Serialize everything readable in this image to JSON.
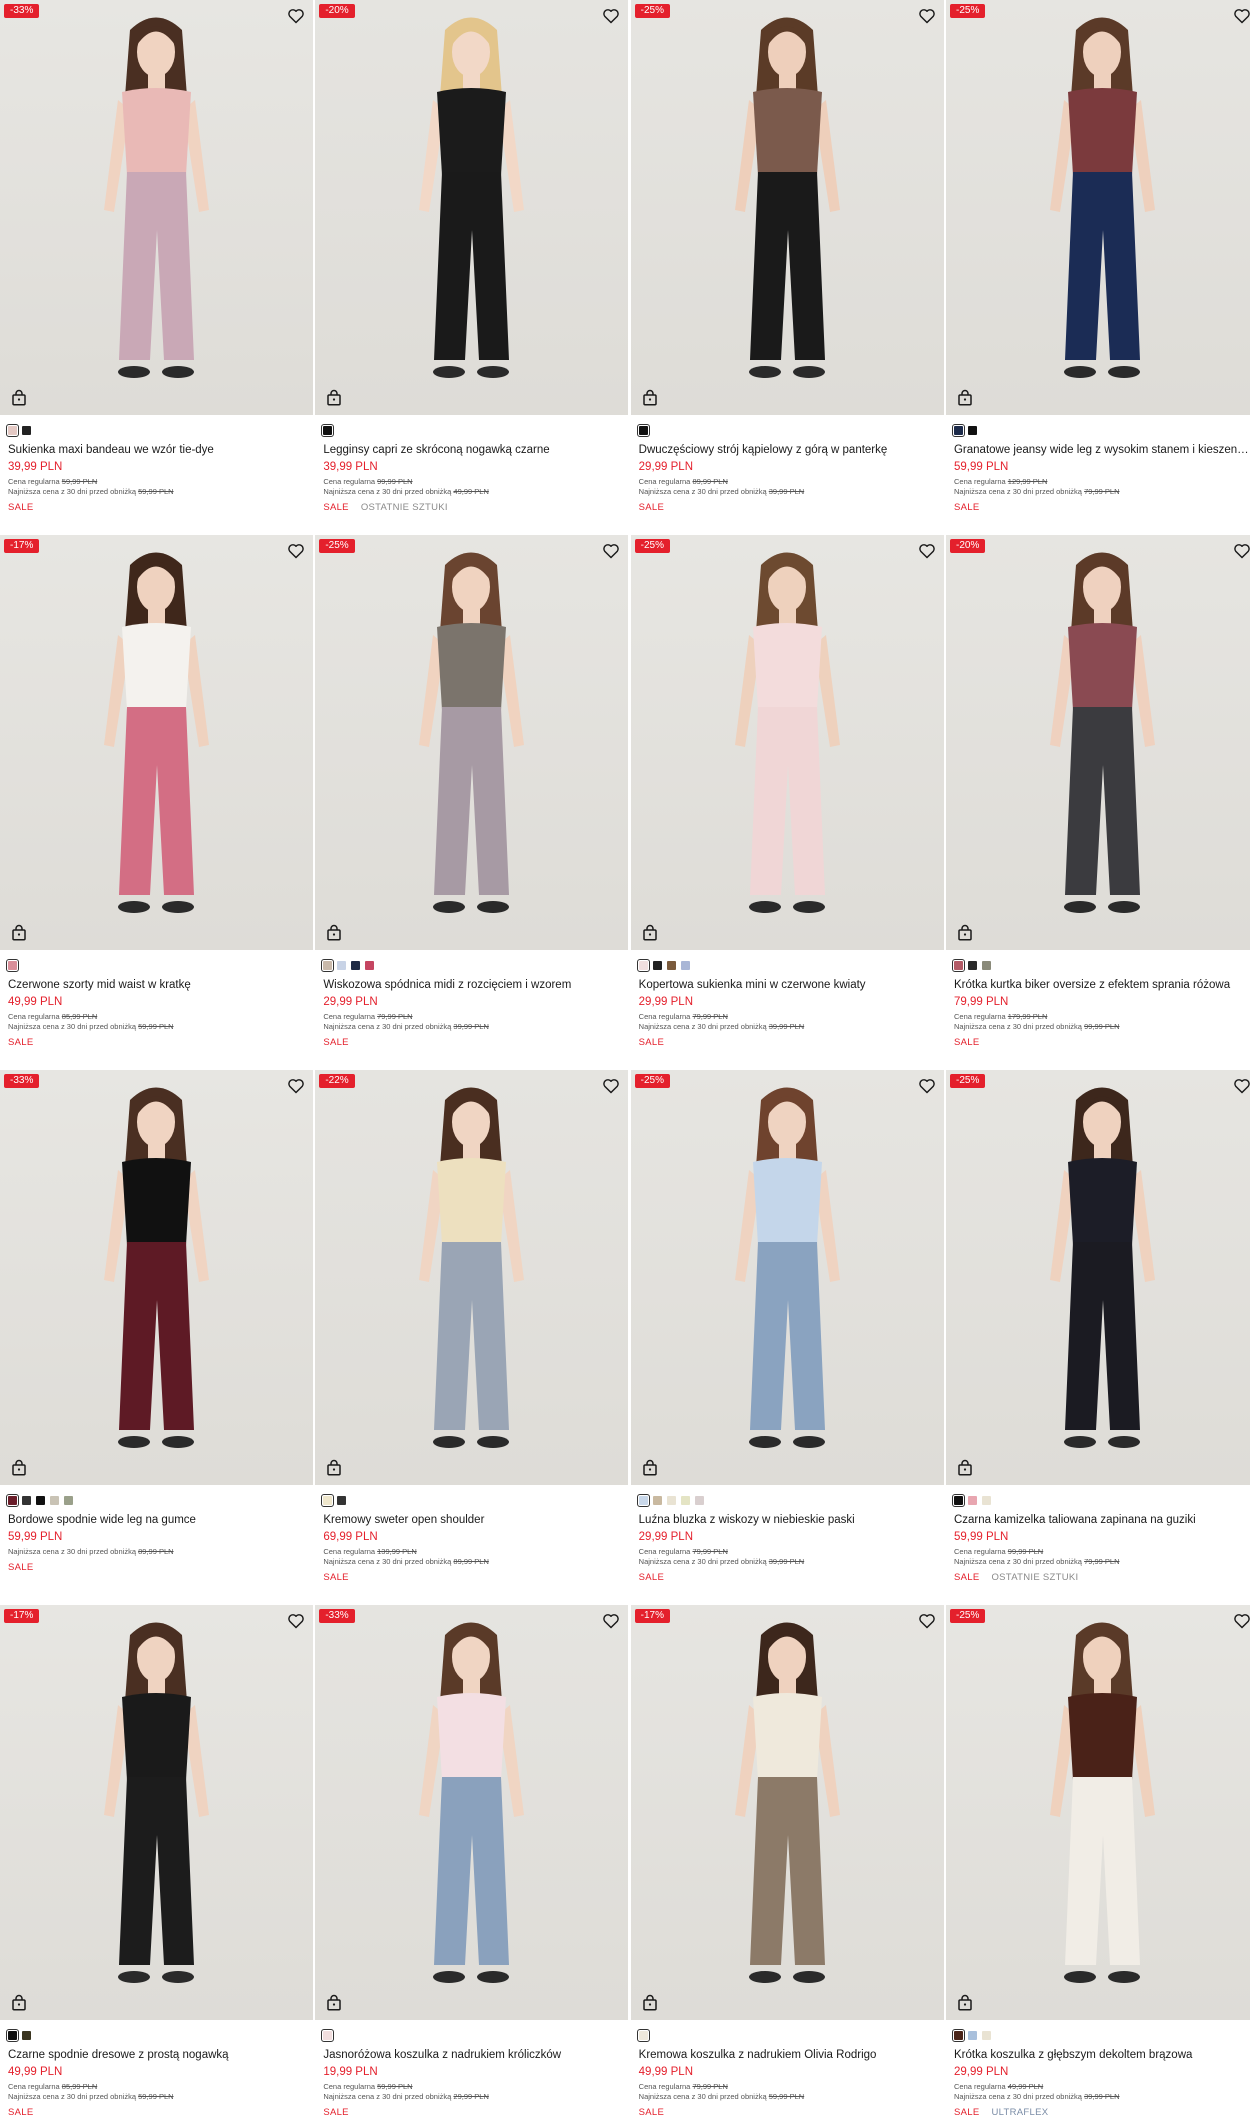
{
  "labels": {
    "regular_prefix": "Cena regularna",
    "lowest_prefix": "Najniższa cena z 30 dni przed obniżką"
  },
  "icons": {
    "wishlist": "heart-outline-icon",
    "quick_add": "shopping-bag-icon"
  },
  "colors": {
    "accent": "#e4202c",
    "text": "#1a1a1a",
    "muted": "#8a8a8a",
    "photo_bg": "#e8e7e4"
  },
  "products": [
    {
      "badge": "-33%",
      "name": "Sukienka maxi bandeau we wzór tie-dye",
      "price": "39,99 PLN",
      "regular": "59,99 PLN",
      "lowest": "59,99 PLN",
      "tags": [
        "SALE"
      ],
      "swatches": [
        "#e4c9c4",
        "#222222"
      ],
      "bg": "#e7e6e2",
      "top": "#e9b9b6",
      "bottom": "#c9a8b6",
      "skin": "#f0d3c1",
      "hair": "#4a2f22"
    },
    {
      "badge": "-20%",
      "name": "Legginsy capri ze skróconą nogawką czarne",
      "price": "39,99 PLN",
      "regular": "99,99 PLN",
      "lowest": "49,99 PLN",
      "tags": [
        "SALE",
        "OSTATNIE SZTUKI"
      ],
      "swatches": [
        "#111111"
      ],
      "bg": "#e5e4e0",
      "top": "#1b1b1b",
      "bottom": "#1a1a1a",
      "skin": "#f2d8c7",
      "hair": "#e3c58c"
    },
    {
      "badge": "-25%",
      "name": "Dwuczęściowy strój kąpielowy z górą w panterkę",
      "price": "29,99 PLN",
      "regular": "89,99 PLN",
      "lowest": "39,99 PLN",
      "tags": [
        "SALE"
      ],
      "swatches": [
        "#111111"
      ],
      "bg": "#e6e5e1",
      "top": "#7b5a4c",
      "bottom": "#1a1a1a",
      "skin": "#eecfbb",
      "hair": "#5b3b27"
    },
    {
      "badge": "-25%",
      "name": "Granatowe jeansy wide leg z wysokim stanem i kieszeniami",
      "price": "59,99 PLN",
      "regular": "129,99 PLN",
      "lowest": "79,99 PLN",
      "tags": [
        "SALE"
      ],
      "swatches": [
        "#1c2a4a",
        "#111111"
      ],
      "bg": "#e6e5e1",
      "top": "#7b3a3d",
      "bottom": "#1b2c55",
      "skin": "#eed0bd",
      "hair": "#5b3a28"
    },
    {
      "badge": "-17%",
      "name": "Czerwone szorty mid waist w kratkę",
      "price": "49,99 PLN",
      "regular": "85,99 PLN",
      "lowest": "59,99 PLN",
      "tags": [
        "SALE"
      ],
      "swatches": [
        "#d98e99"
      ],
      "bg": "#e7e6e2",
      "top": "#f4f2ee",
      "bottom": "#d36e84",
      "skin": "#efd2bf",
      "hair": "#3f271b"
    },
    {
      "badge": "-25%",
      "name": "Wiskozowa spódnica midi z rozcięciem i wzorem",
      "price": "29,99 PLN",
      "regular": "79,99 PLN",
      "lowest": "39,99 PLN",
      "tags": [
        "SALE"
      ],
      "swatches": [
        "#c9b9aa",
        "#c8d3e6",
        "#1e2a44",
        "#c54561"
      ],
      "bg": "#e6e5e1",
      "top": "#7b746c",
      "bottom": "#a79aa4",
      "skin": "#f0d3c0",
      "hair": "#6a4430"
    },
    {
      "badge": "-25%",
      "name": "Kopertowa sukienka mini w czerwone kwiaty",
      "price": "29,99 PLN",
      "regular": "79,99 PLN",
      "lowest": "39,99 PLN",
      "tags": [
        "SALE"
      ],
      "swatches": [
        "#f0dede",
        "#222222",
        "#7a5a3c",
        "#a9b6d6"
      ],
      "bg": "#e7e6e2",
      "top": "#f3dcdc",
      "bottom": "#f0d6d6",
      "skin": "#eed1bd",
      "hair": "#6d4a30"
    },
    {
      "badge": "-20%",
      "name": "Krótka kurtka biker oversize z efektem sprania różowa",
      "price": "79,99 PLN",
      "regular": "179,99 PLN",
      "lowest": "99,99 PLN",
      "tags": [
        "SALE"
      ],
      "swatches": [
        "#b35a66",
        "#2a2a2a",
        "#8a8a7a"
      ],
      "bg": "#e6e5e1",
      "top": "#8a4a52",
      "bottom": "#3b3b3f",
      "skin": "#efd1bf",
      "hair": "#5c3a28"
    },
    {
      "badge": "-33%",
      "name": "Bordowe spodnie wide leg na gumce",
      "price": "59,99 PLN",
      "regular": "",
      "lowest": "89,99 PLN",
      "tags": [
        "SALE"
      ],
      "swatches": [
        "#6a1d2a",
        "#333333",
        "#111111",
        "#c9c3b5",
        "#9aa08a"
      ],
      "bg": "#e7e6e2",
      "top": "#111111",
      "bottom": "#5e1a25",
      "skin": "#f0d4c2",
      "hair": "#4a2f22"
    },
    {
      "badge": "-22%",
      "name": "Kremowy sweter open shoulder",
      "price": "69,99 PLN",
      "regular": "139,99 PLN",
      "lowest": "89,99 PLN",
      "tags": [
        "SALE"
      ],
      "swatches": [
        "#efe7cc",
        "#333333"
      ],
      "bg": "#e5e4e0",
      "top": "#ede0bf",
      "bottom": "#9aa5b5",
      "skin": "#f0d5c3",
      "hair": "#4a2e20"
    },
    {
      "badge": "-25%",
      "name": "Luźna bluzka z wiskozy w niebieskie paski",
      "price": "29,99 PLN",
      "regular": "79,99 PLN",
      "lowest": "39,99 PLN",
      "tags": [
        "SALE"
      ],
      "swatches": [
        "#c9d8ea",
        "#c9b9a0",
        "#e9e3d3",
        "#e4e4c4",
        "#d9cfcf"
      ],
      "bg": "#e6e5e1",
      "top": "#c4d6ea",
      "bottom": "#8aa3c0",
      "skin": "#efd3c1",
      "hair": "#6f432e"
    },
    {
      "badge": "-25%",
      "name": "Czarna kamizelka taliowana zapinana na guziki",
      "price": "59,99 PLN",
      "regular": "99,99 PLN",
      "lowest": "79,99 PLN",
      "tags": [
        "SALE",
        "OSTATNIE SZTUKI"
      ],
      "swatches": [
        "#111111",
        "#e8a6b0",
        "#e9e3d3"
      ],
      "bg": "#e6e5e1",
      "top": "#1c1d27",
      "bottom": "#1b1b22",
      "skin": "#efd2bf",
      "hair": "#3d271c"
    },
    {
      "badge": "-17%",
      "name": "Czarne spodnie dresowe z prostą nogawką",
      "price": "49,99 PLN",
      "regular": "85,99 PLN",
      "lowest": "59,99 PLN",
      "tags": [
        "SALE"
      ],
      "swatches": [
        "#111111",
        "#3a3520"
      ],
      "bg": "#e7e6e2",
      "top": "#1a1a1a",
      "bottom": "#1c1c1c",
      "skin": "#efd3c1",
      "hair": "#4a2f22"
    },
    {
      "badge": "-33%",
      "name": "Jasnoróżowa koszulka z nadrukiem króliczków",
      "price": "19,99 PLN",
      "regular": "59,99 PLN",
      "lowest": "29,99 PLN",
      "tags": [
        "SALE"
      ],
      "swatches": [
        "#f1dede"
      ],
      "bg": "#e5e4e0",
      "top": "#f3dfe3",
      "bottom": "#8aa1bd",
      "skin": "#f0d5c3",
      "hair": "#5a3a28"
    },
    {
      "badge": "-17%",
      "name": "Kremowa koszulka z nadrukiem Olivia Rodrigo",
      "price": "49,99 PLN",
      "regular": "79,99 PLN",
      "lowest": "59,99 PLN",
      "tags": [
        "SALE"
      ],
      "swatches": [
        "#efe9dc"
      ],
      "bg": "#e6e5e1",
      "top": "#efe9dc",
      "bottom": "#8c7a68",
      "skin": "#efd2bf",
      "hair": "#3d271c"
    },
    {
      "badge": "-25%",
      "name": "Krótka koszulka z głębszym dekoltem brązowa",
      "price": "29,99 PLN",
      "regular": "49,99 PLN",
      "lowest": "39,99 PLN",
      "tags": [
        "SALE",
        "ULTRAFLEX"
      ],
      "swatches": [
        "#4a2418",
        "#a9c0dc",
        "#e9e3d3"
      ],
      "bg": "#e7e6e2",
      "top": "#4a2218",
      "bottom": "#f1ede6",
      "skin": "#efd1bd",
      "hair": "#5a3a28"
    }
  ]
}
